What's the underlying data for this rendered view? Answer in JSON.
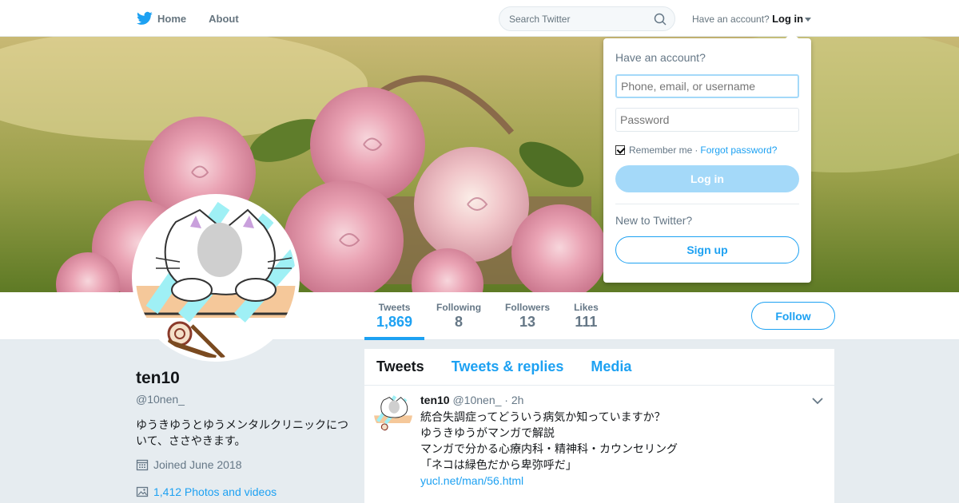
{
  "nav": {
    "home_label": "Home",
    "about_label": "About",
    "search_placeholder": "Search Twitter",
    "account_prompt": "Have an account?",
    "login_label": "Log in"
  },
  "profile": {
    "name": "ten10",
    "handle": "@10nen_",
    "bio": "ゆうきゆうとゆうメンタルクリニックについて、ささやきます。",
    "joined": "Joined June 2018",
    "photos": "1,412 Photos and videos"
  },
  "stats": [
    {
      "label": "Tweets",
      "value": "1,869"
    },
    {
      "label": "Following",
      "value": "8"
    },
    {
      "label": "Followers",
      "value": "13"
    },
    {
      "label": "Likes",
      "value": "111"
    }
  ],
  "follow_label": "Follow",
  "tabs": [
    "Tweets",
    "Tweets & replies",
    "Media"
  ],
  "tweet": {
    "name": "ten10",
    "handle": "@10nen_",
    "time": "· 2h",
    "lines": [
      "統合失調症ってどういう病気か知っていますか？",
      "ゆうきゆうがマンガで解説",
      "マンガで分かる心療内科・精神科・カウンセリング",
      "「ネコは緑色だから卑弥呼だ」"
    ],
    "link": "yucl.net/man/56.html"
  },
  "login_dropdown": {
    "title": "Have an account?",
    "username_placeholder": "Phone, email, or username",
    "password_placeholder": "Password",
    "remember_label": "Remember me",
    "separator": "·",
    "forgot_label": "Forgot password?",
    "login_button": "Log in",
    "new_prompt": "New to Twitter?",
    "signup_button": "Sign up"
  },
  "colors": {
    "brand": "#1da1f2",
    "background": "#e6ecf0",
    "muted": "#657786"
  }
}
